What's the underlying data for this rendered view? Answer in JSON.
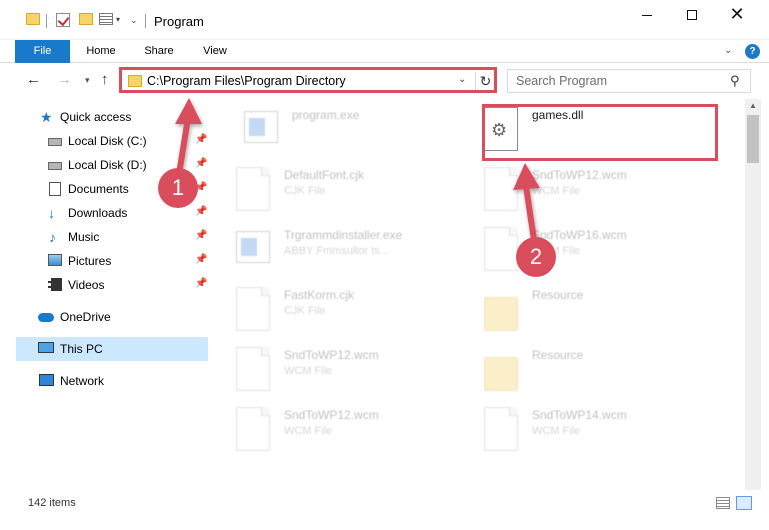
{
  "window": {
    "title": "Program",
    "minimize_glyph": "",
    "maximize_glyph": "",
    "close_glyph": "✕"
  },
  "ribbon": {
    "tabs": [
      "File",
      "Home",
      "Share",
      "View"
    ],
    "help_glyph": "?"
  },
  "navigation": {
    "back_glyph": "←",
    "forward_glyph": "→",
    "recent_glyph": "▾",
    "up_glyph": "↑",
    "address": "C:\\Program Files\\Program Directory",
    "refresh_glyph": "↻",
    "dropdown_glyph": "⌄",
    "search_placeholder": "Search Program",
    "search_glyph": "⚲"
  },
  "sidebar": {
    "items": [
      {
        "label": "Quick access",
        "icon": "star-icon",
        "pinned": false
      },
      {
        "label": "Local Disk (C:)",
        "icon": "disk-icon",
        "pinned": true
      },
      {
        "label": "Local Disk (D:)",
        "icon": "disk-icon",
        "pinned": true
      },
      {
        "label": "Documents",
        "icon": "document-icon",
        "pinned": true
      },
      {
        "label": "Downloads",
        "icon": "download-icon",
        "pinned": true
      },
      {
        "label": "Music",
        "icon": "music-icon",
        "pinned": true
      },
      {
        "label": "Pictures",
        "icon": "pictures-icon",
        "pinned": true
      },
      {
        "label": "Videos",
        "icon": "videos-icon",
        "pinned": true
      },
      {
        "label": "OneDrive",
        "icon": "onedrive-icon",
        "pinned": false
      },
      {
        "label": "This PC",
        "icon": "pc-icon",
        "pinned": false,
        "selected": true
      },
      {
        "label": "Network",
        "icon": "network-icon",
        "pinned": false
      }
    ],
    "pin_glyph": "📌"
  },
  "files": [
    {
      "name": "program.exe",
      "type": "",
      "icon": "exe-icon",
      "faded": true
    },
    {
      "name": "games.dll",
      "type": "",
      "icon": "dll-gear-icon",
      "faded": false,
      "highlighted": true
    },
    {
      "name": "DefaultFont.cjk",
      "type": "CJK File",
      "icon": "blank-file-icon",
      "faded": true
    },
    {
      "name": "SndToWP12.wcm",
      "type": "WCM File",
      "icon": "blank-file-icon",
      "faded": true
    },
    {
      "name": "Trgrammdinstaller.exe",
      "type": "ABBY Fmmsultor ts...",
      "icon": "installer-icon",
      "faded": true
    },
    {
      "name": "SndToWP16.wcm",
      "type": "WCM File",
      "icon": "blank-file-icon",
      "faded": true
    },
    {
      "name": "FastKorm.cjk",
      "type": "CJK File",
      "icon": "blank-file-icon",
      "faded": true
    },
    {
      "name": "Resource",
      "type": "",
      "icon": "folder-icon",
      "faded": true
    },
    {
      "name": "SndToWP12.wcm",
      "type": "WCM File",
      "icon": "blank-file-icon",
      "faded": true
    },
    {
      "name": "Resource",
      "type": "",
      "icon": "folder-icon",
      "faded": true
    },
    {
      "name": "SndToWP12.wcm",
      "type": "WCM File",
      "icon": "blank-file-icon",
      "faded": true
    },
    {
      "name": "SndToWP14.wcm",
      "type": "WCM File",
      "icon": "blank-file-icon",
      "faded": true
    }
  ],
  "status": {
    "item_count": "142 items"
  },
  "annotations": {
    "badge_1": "1",
    "badge_2": "2",
    "color": "#d94d5c"
  }
}
